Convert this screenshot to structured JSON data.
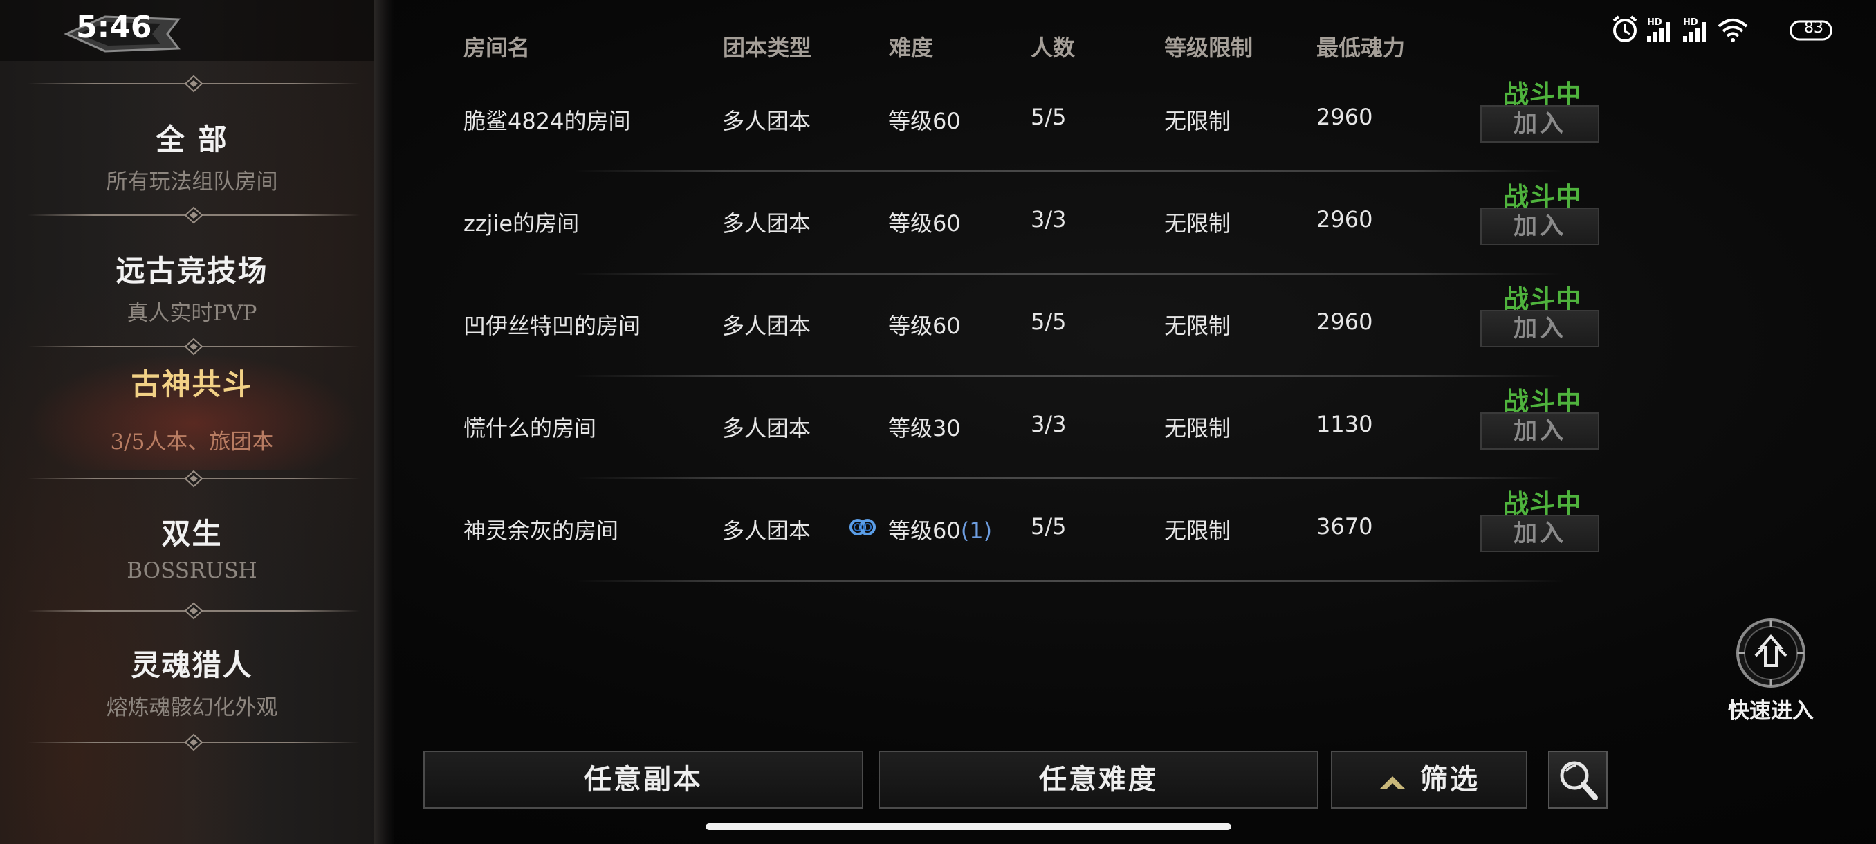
{
  "status_bar": {
    "time": "5:46",
    "battery": "83",
    "icons": [
      "alarm-icon",
      "hd-signal-icon",
      "hd-signal-icon",
      "wifi-icon",
      "battery-icon"
    ]
  },
  "sidebar": {
    "items": [
      {
        "title": "全 部",
        "subtitle": "所有玩法组队房间",
        "active": false
      },
      {
        "title": "远古竞技场",
        "subtitle": "真人实时PVP",
        "active": false
      },
      {
        "title": "古神共斗",
        "subtitle": "3/5人本、旅团本",
        "active": true
      },
      {
        "title": "双生",
        "subtitle": "BOSSRUSH",
        "active": false
      },
      {
        "title": "灵魂猎人",
        "subtitle": "熔炼魂骸幻化外观",
        "active": false
      }
    ]
  },
  "table": {
    "headers": [
      "房间名",
      "团本类型",
      "难度",
      "人数",
      "等级限制",
      "最低魂力"
    ],
    "rows": [
      {
        "room": "脆鲨4824的房间",
        "type": "多人团本",
        "difficulty": "等级60",
        "difficulty_extra": "",
        "linked": false,
        "count": "5/5",
        "level_limit": "无限制",
        "min_soul": "2960",
        "status": "战斗中",
        "join": "加入"
      },
      {
        "room": "zzjie的房间",
        "type": "多人团本",
        "difficulty": "等级60",
        "difficulty_extra": "",
        "linked": false,
        "count": "3/3",
        "level_limit": "无限制",
        "min_soul": "2960",
        "status": "战斗中",
        "join": "加入"
      },
      {
        "room": "凹伊丝特凹的房间",
        "type": "多人团本",
        "difficulty": "等级60",
        "difficulty_extra": "",
        "linked": false,
        "count": "5/5",
        "level_limit": "无限制",
        "min_soul": "2960",
        "status": "战斗中",
        "join": "加入"
      },
      {
        "room": "慌什么的房间",
        "type": "多人团本",
        "difficulty": "等级30",
        "difficulty_extra": "",
        "linked": false,
        "count": "3/3",
        "level_limit": "无限制",
        "min_soul": "1130",
        "status": "战斗中",
        "join": "加入"
      },
      {
        "room": "神灵余灰的房间",
        "type": "多人团本",
        "difficulty": "等级60",
        "difficulty_extra": "(1)",
        "linked": true,
        "count": "5/5",
        "level_limit": "无限制",
        "min_soul": "3670",
        "status": "战斗中",
        "join": "加入"
      }
    ]
  },
  "bottom_bar": {
    "any_dungeon": "任意副本",
    "any_difficulty": "任意难度",
    "filter": "筛选"
  },
  "quick_enter": {
    "label": "快速进入"
  },
  "colors": {
    "fighting": "#4fb33d",
    "active_title": "#f2d186",
    "active_sub": "#b87c62",
    "link_blue": "#6d9de0"
  }
}
